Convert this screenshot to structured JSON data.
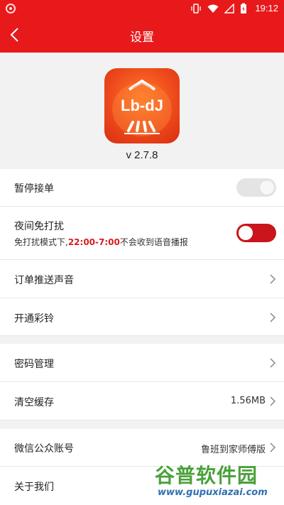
{
  "status_bar": {
    "time": "19:12"
  },
  "header": {
    "title": "设置"
  },
  "about": {
    "version": "v 2.7.8",
    "logo_text": "Lb-dJ"
  },
  "settings": {
    "pause_orders": {
      "label": "暂停接单"
    },
    "night_dnd": {
      "label": "夜间免打扰",
      "desc_prefix": "免打扰模式下,",
      "desc_time": "22:00-7:00",
      "desc_suffix": "不会收到语音播报"
    },
    "order_sound": {
      "label": "订单推送声音"
    },
    "ringtone": {
      "label": "开通彩铃"
    },
    "password": {
      "label": "密码管理"
    },
    "cache": {
      "label": "清空缓存",
      "value": "1.56MB"
    },
    "wechat": {
      "label": "微信公众账号",
      "value": "鲁班到家师傅版"
    },
    "about_us": {
      "label": "关于我们"
    }
  },
  "watermark": {
    "title": "谷普软件园",
    "url": "www.gupuxiazai.com"
  },
  "colors": {
    "brand": "#e8191b",
    "toggle_on": "#c9151b",
    "toggle_off": "#e4e4e4"
  }
}
